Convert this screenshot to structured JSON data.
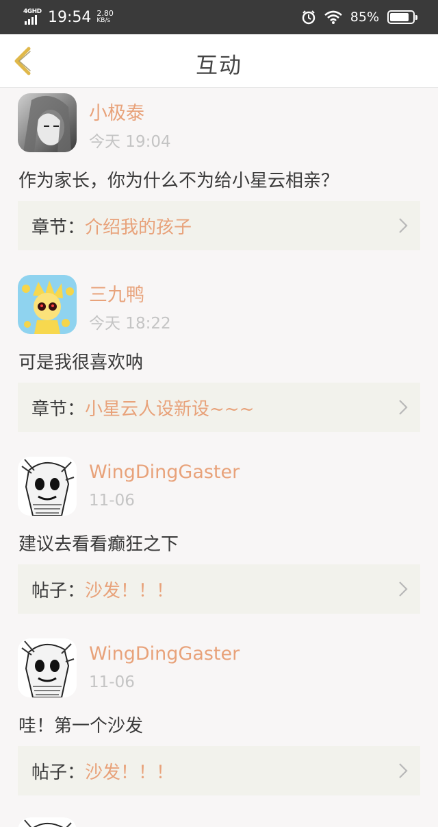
{
  "status_bar": {
    "network": "4GHD",
    "time": "19:54",
    "speed_value": "2.80",
    "speed_unit": "KB/s",
    "battery": "85%",
    "battery_level": 0.85
  },
  "header": {
    "title": "互动",
    "back_icon": "chevron-left-icon",
    "accent_color": "#e0b84a"
  },
  "colors": {
    "username": "#e8a27a",
    "link": "#e8a27a",
    "time": "#c4c4c4",
    "card_bg": "#f2f2ec"
  },
  "items": [
    {
      "user": "小极泰",
      "time": "今天 19:04",
      "message": "作为家长，你为什么不为给小星云相亲？",
      "ref_label": "章节：",
      "ref_title": "介绍我的孩子"
    },
    {
      "user": "三九鸭",
      "time": "今天 18:22",
      "message": "可是我很喜欢呐",
      "ref_label": "章节：",
      "ref_title": "小星云人设新设~~~"
    },
    {
      "user": "WingDingGaster",
      "time": "11-06",
      "message": "建议去看看癫狂之下",
      "ref_label": "帖子：",
      "ref_title": "沙发！！！"
    },
    {
      "user": "WingDingGaster",
      "time": "11-06",
      "message": "哇！第一个沙发",
      "ref_label": "帖子：",
      "ref_title": "沙发！！！"
    }
  ]
}
